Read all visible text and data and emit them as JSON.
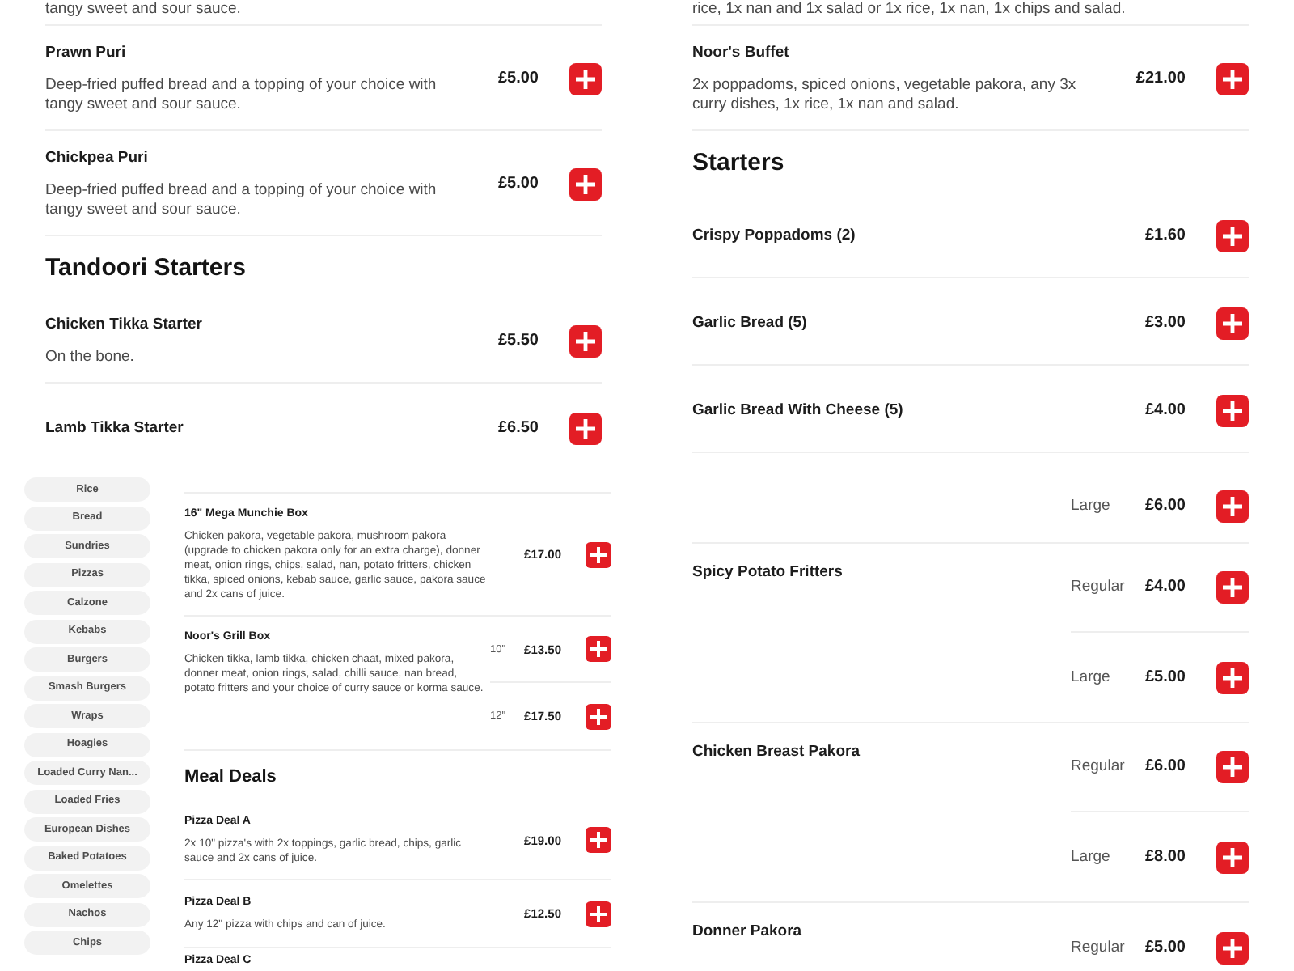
{
  "panels": [
    {
      "kind": "menu",
      "entries": [
        {
          "kind": "text",
          "text": "tangy sweet and sour sauce."
        },
        {
          "kind": "item",
          "name": "Prawn Puri",
          "description": "Deep-fried puffed bread and a topping of your choice with tangy sweet and sour sauce.",
          "price": "£5.00"
        },
        {
          "kind": "item",
          "name": "Chickpea Puri",
          "description": "Deep-fried puffed bread and a topping of your choice with tangy sweet and sour sauce.",
          "price": "£5.00"
        },
        {
          "kind": "heading",
          "text": "Tandoori Starters"
        },
        {
          "kind": "item",
          "name": "Chicken Tikka Starter",
          "description": "On the bone.",
          "price": "£5.50"
        },
        {
          "kind": "item",
          "name": "Lamb Tikka Starter",
          "price": "£6.50"
        }
      ]
    },
    {
      "kind": "menu",
      "entries": [
        {
          "kind": "text",
          "text": "rice, 1x nan and 1x salad or 1x rice, 1x nan, 1x chips and salad."
        },
        {
          "kind": "item",
          "name": "Noor's Buffet",
          "description": "2x poppadoms, spiced onions, vegetable pakora, any 3x curry dishes, 1x rice, 1x nan and salad.",
          "price": "£21.00"
        },
        {
          "kind": "heading",
          "text": "Starters"
        },
        {
          "kind": "item",
          "name": "Crispy Poppadoms (2)",
          "price": "£1.60"
        },
        {
          "kind": "item",
          "name": "Garlic Bread (5)",
          "price": "£3.00"
        },
        {
          "kind": "item",
          "name": "Garlic Bread With Cheese (5)",
          "price": "£4.00"
        }
      ]
    },
    {
      "kind": "menu_with_categories",
      "categories": [
        "Rice",
        "Bread",
        "Sundries",
        "Pizzas",
        "Calzone",
        "Kebabs",
        "Burgers",
        "Smash Burgers",
        "Wraps",
        "Hoagies",
        "Loaded Curry Nan...",
        "Loaded Fries",
        "European Dishes",
        "Baked Potatoes",
        "Omelettes",
        "Nachos",
        "Chips"
      ],
      "entries": [
        {
          "kind": "item",
          "name": "16\" Mega Munchie Box",
          "description": "Chicken pakora, vegetable pakora, mushroom pakora (upgrade to chicken pakora only for an extra charge), donner meat, onion rings, chips, salad, nan, potato fritters, chicken tikka, spiced onions, kebab sauce, garlic sauce, pakora sauce and 2x cans of juice.",
          "price": "£17.00"
        },
        {
          "kind": "item",
          "name": "Noor's Grill Box",
          "description": "Chicken tikka, lamb tikka, chicken chaat, mixed pakora, donner meat, onion rings, salad, chilli sauce, nan bread, potato fritters and your choice of curry sauce or korma sauce.",
          "options": [
            {
              "size": "10\"",
              "price": "£13.50"
            },
            {
              "size": "12\"",
              "price": "£17.50"
            }
          ]
        },
        {
          "kind": "heading",
          "text": "Meal Deals"
        },
        {
          "kind": "item",
          "name": "Pizza Deal A",
          "description": "2x 10\" pizza's with 2x toppings, garlic bread, chips, garlic sauce and 2x cans of juice.",
          "price": "£19.00"
        },
        {
          "kind": "item",
          "name": "Pizza Deal B",
          "description": "Any 12\" pizza with chips and can of juice.",
          "price": "£12.50"
        },
        {
          "kind": "partial",
          "name": "Pizza Deal C"
        }
      ]
    },
    {
      "kind": "menu",
      "entries": [
        {
          "kind": "continued",
          "options": [
            {
              "size": "Large",
              "price": "£6.00"
            }
          ]
        },
        {
          "kind": "item",
          "name": "Spicy Potato Fritters",
          "options": [
            {
              "size": "Regular",
              "price": "£4.00"
            },
            {
              "size": "Large",
              "price": "£5.00"
            }
          ]
        },
        {
          "kind": "item",
          "name": "Chicken Breast Pakora",
          "options": [
            {
              "size": "Regular",
              "price": "£6.00"
            },
            {
              "size": "Large",
              "price": "£8.00"
            }
          ]
        },
        {
          "kind": "item",
          "name": "Donner Pakora",
          "options": [
            {
              "size": "Regular",
              "price": "£5.00"
            }
          ]
        }
      ]
    }
  ]
}
